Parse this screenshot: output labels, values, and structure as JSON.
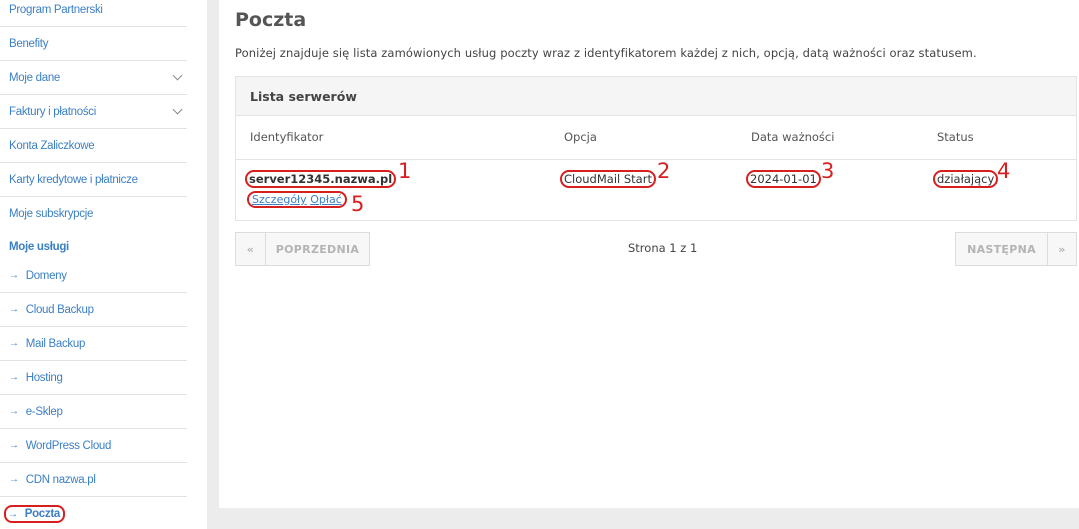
{
  "sidebar": {
    "items": [
      {
        "label": "Program Partnerski"
      },
      {
        "label": "Benefity"
      },
      {
        "label": "Moje dane"
      },
      {
        "label": "Faktury i płatności"
      },
      {
        "label": "Konta Zaliczkowe"
      },
      {
        "label": "Karty kredytowe i płatnicze"
      },
      {
        "label": "Moje subskrypcje"
      }
    ],
    "section_heading": "Moje usługi",
    "arrow_glyph": "→",
    "services": [
      {
        "label": "Domeny"
      },
      {
        "label": "Cloud Backup"
      },
      {
        "label": "Mail Backup"
      },
      {
        "label": "Hosting"
      },
      {
        "label": "e-Sklep"
      },
      {
        "label": "WordPress Cloud"
      },
      {
        "label": "CDN nazwa.pl"
      },
      {
        "label": "Poczta"
      }
    ]
  },
  "main": {
    "title": "Poczta",
    "description": "Poniżej znajduje się lista zamówionych usług poczty wraz z identyfikatorem każdej z nich, opcją, datą ważności oraz statusem.",
    "panel_title": "Lista serwerów",
    "columns": [
      "Identyfikator",
      "Opcja",
      "Data ważności",
      "Status"
    ],
    "rows": [
      {
        "identifier": "server12345.nazwa.pl",
        "option": "CloudMail Start",
        "expiry": "2024-01-01",
        "status": "działający",
        "link_details": "Szczegóły",
        "link_pay": "Opłać"
      }
    ],
    "annotations": [
      "1",
      "2",
      "3",
      "4",
      "5"
    ]
  },
  "pagination": {
    "first": "«",
    "prev": "POPRZEDNIA",
    "info": "Strona 1 z 1",
    "next": "NASTĘPNA",
    "last": "»"
  },
  "colors": {
    "link": "#3b7fc4",
    "highlight": "#d62020",
    "background": "#ececec"
  }
}
